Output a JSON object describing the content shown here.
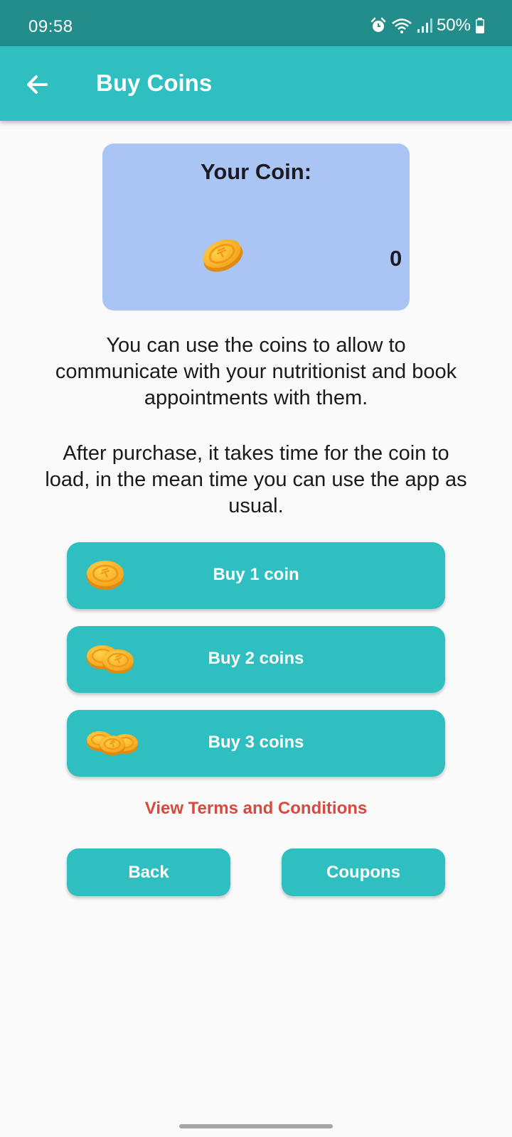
{
  "status_bar": {
    "time": "09:58",
    "battery": "50%",
    "icons": [
      "alarm-icon",
      "wifi-icon",
      "signal-icon",
      "battery-icon"
    ]
  },
  "app_bar": {
    "title": "Buy Coins",
    "back_icon": "arrow-left-icon"
  },
  "coin_card": {
    "title": "Your Coin:",
    "count": "0",
    "icon": "coin-icon"
  },
  "info": {
    "paragraph1": "You can use the coins to allow to communicate with your nutritionist and book appointments with them.",
    "paragraph2": "After purchase, it takes time for the coin to load, in the mean time you can use the app as usual."
  },
  "purchase_options": [
    {
      "label": "Buy 1 coin",
      "icon": "single-coin-icon"
    },
    {
      "label": "Buy 2 coins",
      "icon": "two-coins-icon"
    },
    {
      "label": "Buy 3 coins",
      "icon": "three-coins-icon"
    }
  ],
  "terms_link": "View Terms and Conditions",
  "actions": {
    "back_label": "Back",
    "coupons_label": "Coupons"
  },
  "colors": {
    "primary": "#2fbfc0",
    "status_bar": "#228d8b",
    "card_background": "#aac4f4",
    "link": "#d8493e",
    "coin": "#f5a623"
  }
}
